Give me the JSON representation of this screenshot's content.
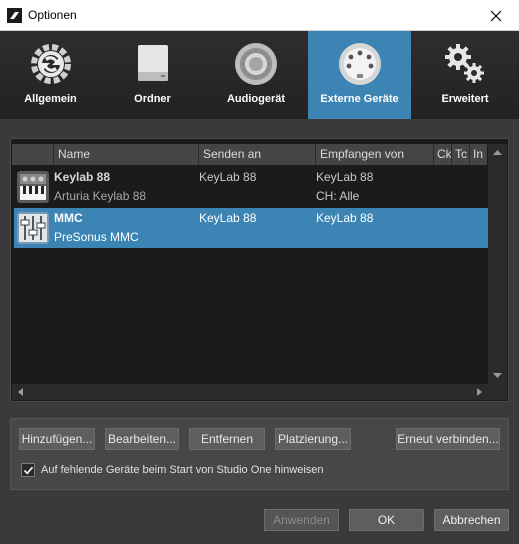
{
  "window": {
    "title": "Optionen"
  },
  "tabs": [
    {
      "label": "Allgemein",
      "icon": "gears-refresh-icon"
    },
    {
      "label": "Ordner",
      "icon": "drive-icon"
    },
    {
      "label": "Audiogerät",
      "icon": "speaker-icon"
    },
    {
      "label": "Externe Geräte",
      "icon": "midi-port-icon",
      "active": true
    },
    {
      "label": "Erweitert",
      "icon": "gears-icon"
    }
  ],
  "table": {
    "columns": [
      "Name",
      "Senden an",
      "Empfangen von",
      "Ck",
      "Tc",
      "In"
    ],
    "rows": [
      {
        "name": "Keylab 88",
        "model": "Arturia Keylab 88",
        "send_to": "KeyLab 88",
        "receive_from": "KeyLab 88",
        "channel": "CH: Alle",
        "icon": "keyboard-icon",
        "selected": false
      },
      {
        "name": "MMC",
        "model": "PreSonus MMC",
        "send_to": "KeyLab 88",
        "receive_from": "KeyLab 88",
        "channel": "",
        "icon": "mixer-icon",
        "selected": true
      }
    ]
  },
  "actions": {
    "add": "Hinzufügen...",
    "edit": "Bearbeiten...",
    "remove": "Entfernen",
    "placement": "Platzierung...",
    "reconnect": "Erneut verbinden..."
  },
  "notify_checkbox": {
    "label": "Auf fehlende Geräte beim Start von Studio One hinweisen",
    "checked": true
  },
  "dialog": {
    "apply": "Anwenden",
    "ok": "OK",
    "cancel": "Abbrechen"
  },
  "colors": {
    "accent": "#3b84b3",
    "background": "#3a3a3a"
  }
}
